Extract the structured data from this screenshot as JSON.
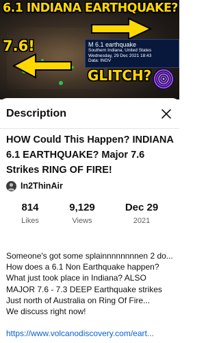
{
  "thumbnail": {
    "headline": "6.1 INDIANA EARTHQUAKE?",
    "magnitude_callout": "7.6!",
    "glitch_callout": "GLITCH?",
    "info_card": {
      "title": "M 6.1 earthquake",
      "location": "Southern Indiana, United States",
      "date": "Wednesday, 29 Dec 2021 18:43",
      "source": "Data: INGV"
    },
    "colors": {
      "headline": "#ffd800",
      "arrow": "#ffd800",
      "quake_dot": "#23c552",
      "card_bg": "#08183d"
    }
  },
  "panel": {
    "title": "Description",
    "close_icon": "close-icon"
  },
  "video": {
    "title": "HOW Could This Happen? INDIANA 6.1 EARTHQUAKE? Major 7.6 Strikes RING OF FIRE!",
    "channel": "In2ThinAir"
  },
  "stats": {
    "likes": {
      "value": "814",
      "label": "Likes"
    },
    "views": {
      "value": "9,129",
      "label": "Views"
    },
    "date": {
      "value": "Dec 29",
      "label": "2021"
    }
  },
  "description": {
    "text": "Someone's got some splainnnnnnnnen 2 do...\nHow does a 6.1 Non Earthquake happen? What just took place in Indiana?  ALSO MAJOR 7.6 - 7.3 DEEP Earthquake strikes Just north of Australia on Ring Of Fire...\nWe discuss right now!",
    "link": "https://www.volcanodiscovery.com/eart..."
  },
  "theme": {
    "link_color": "#065fd4",
    "muted_text": "#606060"
  }
}
